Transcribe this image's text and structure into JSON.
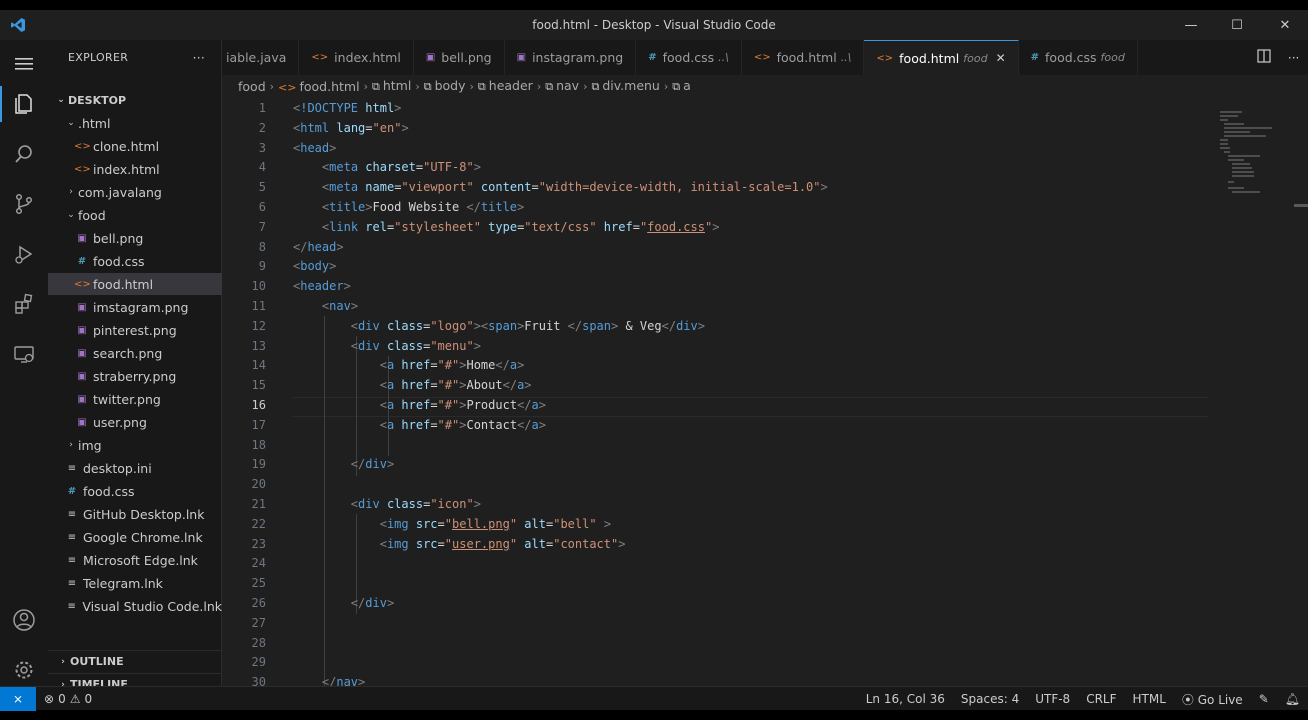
{
  "window": {
    "title": "food.html - Desktop - Visual Studio Code"
  },
  "sidebar": {
    "header": "EXPLORER",
    "root": "DESKTOP",
    "tree": [
      {
        "label": ".html",
        "type": "folder",
        "depth": 1,
        "open": true
      },
      {
        "label": "clone.html",
        "type": "html",
        "depth": 2
      },
      {
        "label": "index.html",
        "type": "html",
        "depth": 2
      },
      {
        "label": "com.javalang",
        "type": "folder",
        "depth": 1,
        "open": false
      },
      {
        "label": "food",
        "type": "folder",
        "depth": 1,
        "open": true
      },
      {
        "label": "bell.png",
        "type": "png",
        "depth": 2
      },
      {
        "label": "food.css",
        "type": "css",
        "depth": 2
      },
      {
        "label": "food.html",
        "type": "html",
        "depth": 2,
        "selected": true
      },
      {
        "label": "imstagram.png",
        "type": "png",
        "depth": 2
      },
      {
        "label": "pinterest.png",
        "type": "png",
        "depth": 2
      },
      {
        "label": "search.png",
        "type": "png",
        "depth": 2
      },
      {
        "label": "straberry.png",
        "type": "png",
        "depth": 2
      },
      {
        "label": "twitter.png",
        "type": "png",
        "depth": 2
      },
      {
        "label": "user.png",
        "type": "png",
        "depth": 2
      },
      {
        "label": "img",
        "type": "folder",
        "depth": 1,
        "open": false
      },
      {
        "label": "desktop.ini",
        "type": "lnk",
        "depth": 1
      },
      {
        "label": "food.css",
        "type": "css",
        "depth": 1
      },
      {
        "label": "GitHub Desktop.lnk",
        "type": "lnk",
        "depth": 1
      },
      {
        "label": "Google Chrome.lnk",
        "type": "lnk",
        "depth": 1
      },
      {
        "label": "Microsoft Edge.lnk",
        "type": "lnk",
        "depth": 1
      },
      {
        "label": "Telegram.lnk",
        "type": "lnk",
        "depth": 1
      },
      {
        "label": "Visual Studio Code.lnk",
        "type": "lnk",
        "depth": 1
      }
    ],
    "outline": "OUTLINE",
    "timeline": "TIMELINE"
  },
  "tabs": [
    {
      "label": "iable.java",
      "icon": "",
      "desc": ""
    },
    {
      "label": "index.html",
      "icon": "html",
      "desc": ""
    },
    {
      "label": "bell.png",
      "icon": "png",
      "desc": ""
    },
    {
      "label": "instagram.png",
      "icon": "png",
      "desc": ""
    },
    {
      "label": "food.css",
      "icon": "css",
      "desc": "..\\"
    },
    {
      "label": "food.html",
      "icon": "html",
      "desc": "..\\"
    },
    {
      "label": "food.html",
      "icon": "html",
      "desc": "food",
      "active": true
    },
    {
      "label": "food.css",
      "icon": "css",
      "desc": "food"
    }
  ],
  "breadcrumb": [
    "food",
    "food.html",
    "html",
    "body",
    "header",
    "nav",
    "div.menu",
    "a"
  ],
  "editor": {
    "current_line": 16,
    "lines": [
      {
        "n": "1",
        "code": "<!DOCTYPE html>"
      },
      {
        "n": "2",
        "code": "<html lang=\"en\">"
      },
      {
        "n": "3",
        "code": "<head>"
      },
      {
        "n": "4",
        "code": "    <meta charset=\"UTF-8\">"
      },
      {
        "n": "5",
        "code": "    <meta name=\"viewport\" content=\"width=device-width, initial-scale=1.0\">"
      },
      {
        "n": "6",
        "code": "    <title>Food Website </title>"
      },
      {
        "n": "7",
        "code": "    <link rel=\"stylesheet\" type=\"text/css\" href=\"food.css\">"
      },
      {
        "n": "8",
        "code": "</head>"
      },
      {
        "n": "9",
        "code": "<body>"
      },
      {
        "n": "10",
        "code": "<header>"
      },
      {
        "n": "11",
        "code": "    <nav>"
      },
      {
        "n": "12",
        "code": "        <div class=\"logo\"><span>Fruit </span> & Veg</div>"
      },
      {
        "n": "13",
        "code": "        <div class=\"menu\">"
      },
      {
        "n": "14",
        "code": "            <a href=\"#\">Home</a>"
      },
      {
        "n": "15",
        "code": "            <a href=\"#\">About</a>"
      },
      {
        "n": "16",
        "code": "            <a href=\"#\">Product</a>"
      },
      {
        "n": "17",
        "code": "            <a href=\"#\">Contact</a>"
      },
      {
        "n": "18",
        "code": ""
      },
      {
        "n": "19",
        "code": "        </div>"
      },
      {
        "n": "20",
        "code": ""
      },
      {
        "n": "21",
        "code": "        <div class=\"icon\">"
      },
      {
        "n": "22",
        "code": "            <img src=\"bell.png\" alt=\"bell\" >"
      },
      {
        "n": "23",
        "code": "            <img src=\"user.png\" alt=\"contact\">"
      },
      {
        "n": "24",
        "code": ""
      },
      {
        "n": "25",
        "code": ""
      },
      {
        "n": "26",
        "code": "        </div>"
      },
      {
        "n": "27",
        "code": ""
      },
      {
        "n": "28",
        "code": ""
      },
      {
        "n": "29",
        "code": ""
      },
      {
        "n": "30",
        "code": "    </nav>"
      }
    ]
  },
  "status": {
    "errors": "0",
    "warnings": "0",
    "position": "Ln 16, Col 36",
    "spaces": "Spaces: 4",
    "encoding": "UTF-8",
    "eol": "CRLF",
    "language": "HTML",
    "golive": "Go Live"
  },
  "colors": {
    "accent": "#0078d4",
    "tag": "#569cd6",
    "attr": "#9cdcfe",
    "string": "#ce9178"
  }
}
